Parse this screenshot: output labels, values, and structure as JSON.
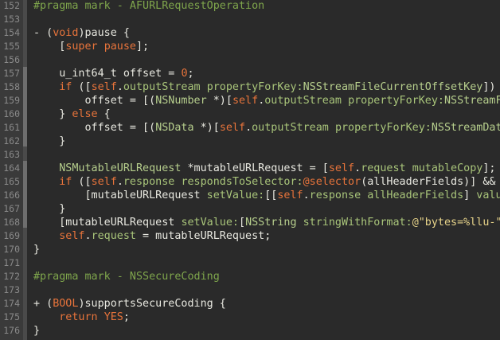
{
  "colors": {
    "background": "#2a2a2a",
    "gutter": "#3a3a3a",
    "line_number": "#8a8a8a",
    "plain": "#e8e8e0",
    "keyword": "#e8743b",
    "pragma": "#7fa64c",
    "method": "#a9c57a",
    "class": "#b7cf8d",
    "string": "#e8d48a"
  },
  "lines": [
    {
      "num": "152",
      "tokens": [
        {
          "t": "pragma",
          "v": "#pragma mark - AFURLRequestOperation"
        }
      ]
    },
    {
      "num": "153",
      "tokens": []
    },
    {
      "num": "154",
      "tokens": [
        {
          "t": "plain",
          "v": "- ("
        },
        {
          "t": "keyword",
          "v": "void"
        },
        {
          "t": "plain",
          "v": ")pause {"
        }
      ]
    },
    {
      "num": "155",
      "tokens": [
        {
          "t": "plain",
          "v": "    ["
        },
        {
          "t": "keyword",
          "v": "super"
        },
        {
          "t": "plain",
          "v": " "
        },
        {
          "t": "keyword",
          "v": "pause"
        },
        {
          "t": "plain",
          "v": "];"
        }
      ]
    },
    {
      "num": "156",
      "tokens": []
    },
    {
      "num": "157",
      "tokens": [
        {
          "t": "plain",
          "v": "    u_int64_t offset = "
        },
        {
          "t": "num",
          "v": "0"
        },
        {
          "t": "plain",
          "v": ";"
        }
      ]
    },
    {
      "num": "158",
      "tokens": [
        {
          "t": "plain",
          "v": "    "
        },
        {
          "t": "keyword",
          "v": "if"
        },
        {
          "t": "plain",
          "v": " (["
        },
        {
          "t": "keyword",
          "v": "self"
        },
        {
          "t": "plain",
          "v": "."
        },
        {
          "t": "method",
          "v": "outputStream"
        },
        {
          "t": "plain",
          "v": " "
        },
        {
          "t": "method",
          "v": "propertyForKey:"
        },
        {
          "t": "class",
          "v": "NSStreamFileCurrentOffsetKey"
        },
        {
          "t": "plain",
          "v": "]) -"
        }
      ]
    },
    {
      "num": "159",
      "tokens": [
        {
          "t": "plain",
          "v": "        offset = [("
        },
        {
          "t": "class",
          "v": "NSNumber"
        },
        {
          "t": "plain",
          "v": " *)["
        },
        {
          "t": "keyword",
          "v": "self"
        },
        {
          "t": "plain",
          "v": "."
        },
        {
          "t": "method",
          "v": "outputStream"
        },
        {
          "t": "plain",
          "v": " "
        },
        {
          "t": "method",
          "v": "propertyForKey:"
        },
        {
          "t": "class",
          "v": "NSStreamFi"
        }
      ]
    },
    {
      "num": "160",
      "tokens": [
        {
          "t": "plain",
          "v": "    } "
        },
        {
          "t": "keyword",
          "v": "else"
        },
        {
          "t": "plain",
          "v": " {"
        }
      ]
    },
    {
      "num": "161",
      "tokens": [
        {
          "t": "plain",
          "v": "        offset = [("
        },
        {
          "t": "class",
          "v": "NSData"
        },
        {
          "t": "plain",
          "v": " *)["
        },
        {
          "t": "keyword",
          "v": "self"
        },
        {
          "t": "plain",
          "v": "."
        },
        {
          "t": "method",
          "v": "outputStream"
        },
        {
          "t": "plain",
          "v": " "
        },
        {
          "t": "method",
          "v": "propertyForKey:"
        },
        {
          "t": "class",
          "v": "NSStreamData"
        }
      ]
    },
    {
      "num": "162",
      "tokens": [
        {
          "t": "plain",
          "v": "    }"
        }
      ]
    },
    {
      "num": "163",
      "tokens": []
    },
    {
      "num": "164",
      "tokens": [
        {
          "t": "plain",
          "v": "    "
        },
        {
          "t": "class",
          "v": "NSMutableURLRequest"
        },
        {
          "t": "plain",
          "v": " *mutableURLRequest = ["
        },
        {
          "t": "keyword",
          "v": "self"
        },
        {
          "t": "plain",
          "v": "."
        },
        {
          "t": "method",
          "v": "request"
        },
        {
          "t": "plain",
          "v": " "
        },
        {
          "t": "method",
          "v": "mutableCopy"
        },
        {
          "t": "plain",
          "v": "];"
        }
      ]
    },
    {
      "num": "165",
      "tokens": [
        {
          "t": "plain",
          "v": "    "
        },
        {
          "t": "keyword",
          "v": "if"
        },
        {
          "t": "plain",
          "v": " (["
        },
        {
          "t": "keyword",
          "v": "self"
        },
        {
          "t": "plain",
          "v": "."
        },
        {
          "t": "method",
          "v": "response"
        },
        {
          "t": "plain",
          "v": " "
        },
        {
          "t": "method",
          "v": "respondsToSelector:"
        },
        {
          "t": "keyword",
          "v": "@selector"
        },
        {
          "t": "plain",
          "v": "(allHeaderFields)] &&"
        }
      ]
    },
    {
      "num": "166",
      "tokens": [
        {
          "t": "plain",
          "v": "        [mutableURLRequest "
        },
        {
          "t": "method",
          "v": "setValue:"
        },
        {
          "t": "plain",
          "v": "[["
        },
        {
          "t": "keyword",
          "v": "self"
        },
        {
          "t": "plain",
          "v": "."
        },
        {
          "t": "method",
          "v": "response"
        },
        {
          "t": "plain",
          "v": " "
        },
        {
          "t": "method",
          "v": "allHeaderFields"
        },
        {
          "t": "plain",
          "v": "] "
        },
        {
          "t": "method",
          "v": "value"
        }
      ]
    },
    {
      "num": "167",
      "tokens": [
        {
          "t": "plain",
          "v": "    }"
        }
      ]
    },
    {
      "num": "168",
      "tokens": [
        {
          "t": "plain",
          "v": "    [mutableURLRequest "
        },
        {
          "t": "method",
          "v": "setValue:"
        },
        {
          "t": "plain",
          "v": "["
        },
        {
          "t": "class",
          "v": "NSString"
        },
        {
          "t": "plain",
          "v": " "
        },
        {
          "t": "method",
          "v": "stringWithFormat:"
        },
        {
          "t": "string",
          "v": "@\"bytes=%llu-\""
        }
      ]
    },
    {
      "num": "169",
      "tokens": [
        {
          "t": "plain",
          "v": "    "
        },
        {
          "t": "keyword",
          "v": "self"
        },
        {
          "t": "plain",
          "v": "."
        },
        {
          "t": "method",
          "v": "request"
        },
        {
          "t": "plain",
          "v": " = mutableURLRequest;"
        }
      ]
    },
    {
      "num": "170",
      "tokens": [
        {
          "t": "plain",
          "v": "}"
        }
      ]
    },
    {
      "num": "171",
      "tokens": []
    },
    {
      "num": "172",
      "tokens": [
        {
          "t": "pragma",
          "v": "#pragma mark - NSSecureCoding"
        }
      ]
    },
    {
      "num": "173",
      "tokens": []
    },
    {
      "num": "174",
      "tokens": [
        {
          "t": "plain",
          "v": "+ ("
        },
        {
          "t": "keyword",
          "v": "BOOL"
        },
        {
          "t": "plain",
          "v": ")supportsSecureCoding {"
        }
      ]
    },
    {
      "num": "175",
      "tokens": [
        {
          "t": "plain",
          "v": "    "
        },
        {
          "t": "keyword",
          "v": "return"
        },
        {
          "t": "plain",
          "v": " "
        },
        {
          "t": "keyword",
          "v": "YES"
        },
        {
          "t": "plain",
          "v": ";"
        }
      ]
    },
    {
      "num": "176",
      "tokens": [
        {
          "t": "plain",
          "v": "}"
        }
      ]
    }
  ]
}
